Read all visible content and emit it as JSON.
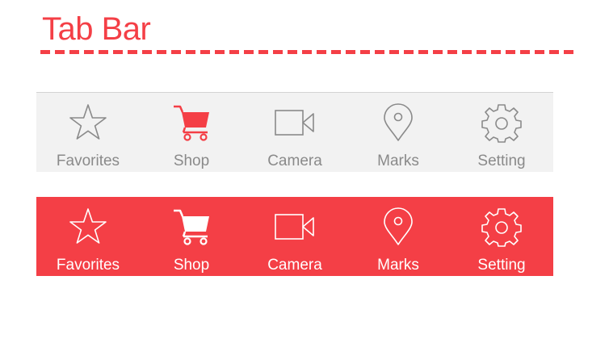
{
  "title": "Tab Bar",
  "colors": {
    "accent": "#f43f46",
    "inactive_icon": "#8a8a8a",
    "bar_light": "#f2f2f2",
    "white": "#ffffff"
  },
  "tabbar_light": {
    "active_index": 1,
    "tabs": [
      {
        "label": "Favorites",
        "icon": "star-icon"
      },
      {
        "label": "Shop",
        "icon": "cart-icon"
      },
      {
        "label": "Camera",
        "icon": "video-camera-icon"
      },
      {
        "label": "Marks",
        "icon": "map-pin-icon"
      },
      {
        "label": "Setting",
        "icon": "gear-icon"
      }
    ]
  },
  "tabbar_red": {
    "active_index": 1,
    "tabs": [
      {
        "label": "Favorites",
        "icon": "star-icon"
      },
      {
        "label": "Shop",
        "icon": "cart-icon"
      },
      {
        "label": "Camera",
        "icon": "video-camera-icon"
      },
      {
        "label": "Marks",
        "icon": "map-pin-icon"
      },
      {
        "label": "Setting",
        "icon": "gear-icon"
      }
    ]
  }
}
